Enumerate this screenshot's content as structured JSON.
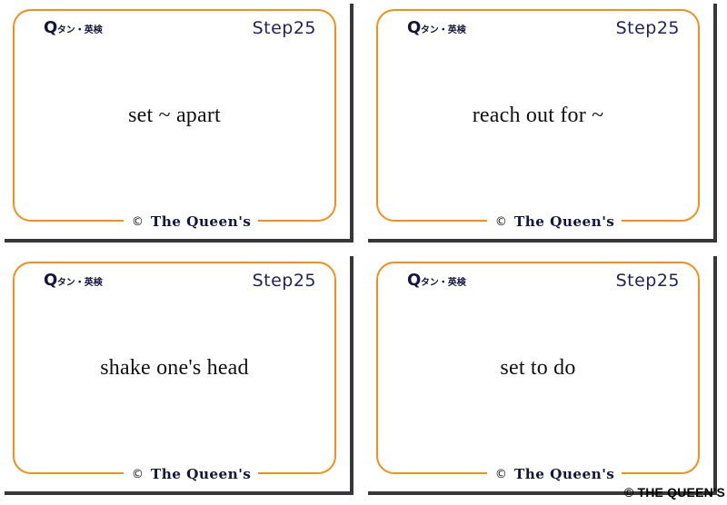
{
  "page": {
    "watermark": "© THE QUEEN'S",
    "accent_color": "#f3901a",
    "step_color": "#22225e",
    "shadow_color": "#38383a",
    "background": "#ffffff"
  },
  "brand": {
    "mark": "Q",
    "subtitle": "タン・英検"
  },
  "footer": {
    "copyright_symbol": "©",
    "name": "The Queen's"
  },
  "cards": [
    {
      "step": "Step25",
      "brand_mark": "Q",
      "brand_subtitle": "タン・英検",
      "phrase": "set ~ apart",
      "copyright_symbol": "©",
      "signature": "The Queen's"
    },
    {
      "step": "Step25",
      "brand_mark": "Q",
      "brand_subtitle": "タン・英検",
      "phrase": "reach out for ~",
      "copyright_symbol": "©",
      "signature": "The Queen's"
    },
    {
      "step": "Step25",
      "brand_mark": "Q",
      "brand_subtitle": "タン・英検",
      "phrase": "shake one's head",
      "copyright_symbol": "©",
      "signature": "The Queen's"
    },
    {
      "step": "Step25",
      "brand_mark": "Q",
      "brand_subtitle": "タン・英検",
      "phrase": "set to do",
      "copyright_symbol": "©",
      "signature": "The Queen's"
    }
  ]
}
